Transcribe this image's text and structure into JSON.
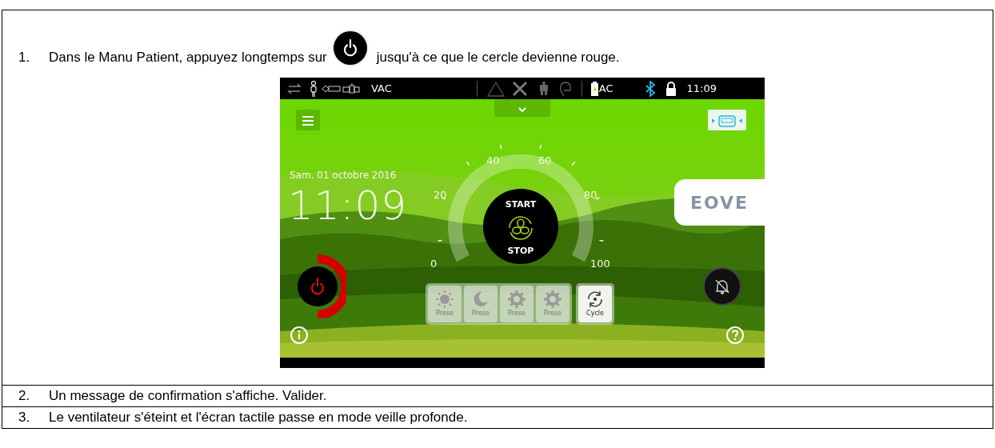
{
  "steps": [
    {
      "kind": "screenshot",
      "number": "1.",
      "text_before": "Dans le Manu Patient, appuyez longtemps sur",
      "text_after": "jusqu'à ce que le cercle devienne rouge.",
      "device": {
        "status_bar": {
          "mode": "VAC",
          "power": "AC",
          "bluetooth": true,
          "locked": true,
          "time": "11:09"
        },
        "date": "Sam. 01 octobre 2016",
        "time": "11:09",
        "gauge": {
          "ticks": [
            "0",
            "20",
            "40",
            "60",
            "80",
            "100"
          ],
          "start": "START",
          "stop": "STOP"
        },
        "logo": "EOVE",
        "presets": [
          {
            "label": "Prese",
            "kind": "sun",
            "disabled": true
          },
          {
            "label": "Prese",
            "kind": "moon",
            "disabled": true
          },
          {
            "label": "Prese",
            "kind": "gear",
            "disabled": true
          },
          {
            "label": "Prese",
            "kind": "gear",
            "disabled": true
          }
        ],
        "cycle": {
          "label": "Cycle",
          "disabled": false
        }
      }
    },
    {
      "kind": "text",
      "number": "2.",
      "text": "Un message de confirmation s'affiche. Valider."
    },
    {
      "kind": "text",
      "number": "3.",
      "text": "Le ventilateur s'éteint et l'écran tactile passe en mode veille profonde."
    }
  ]
}
